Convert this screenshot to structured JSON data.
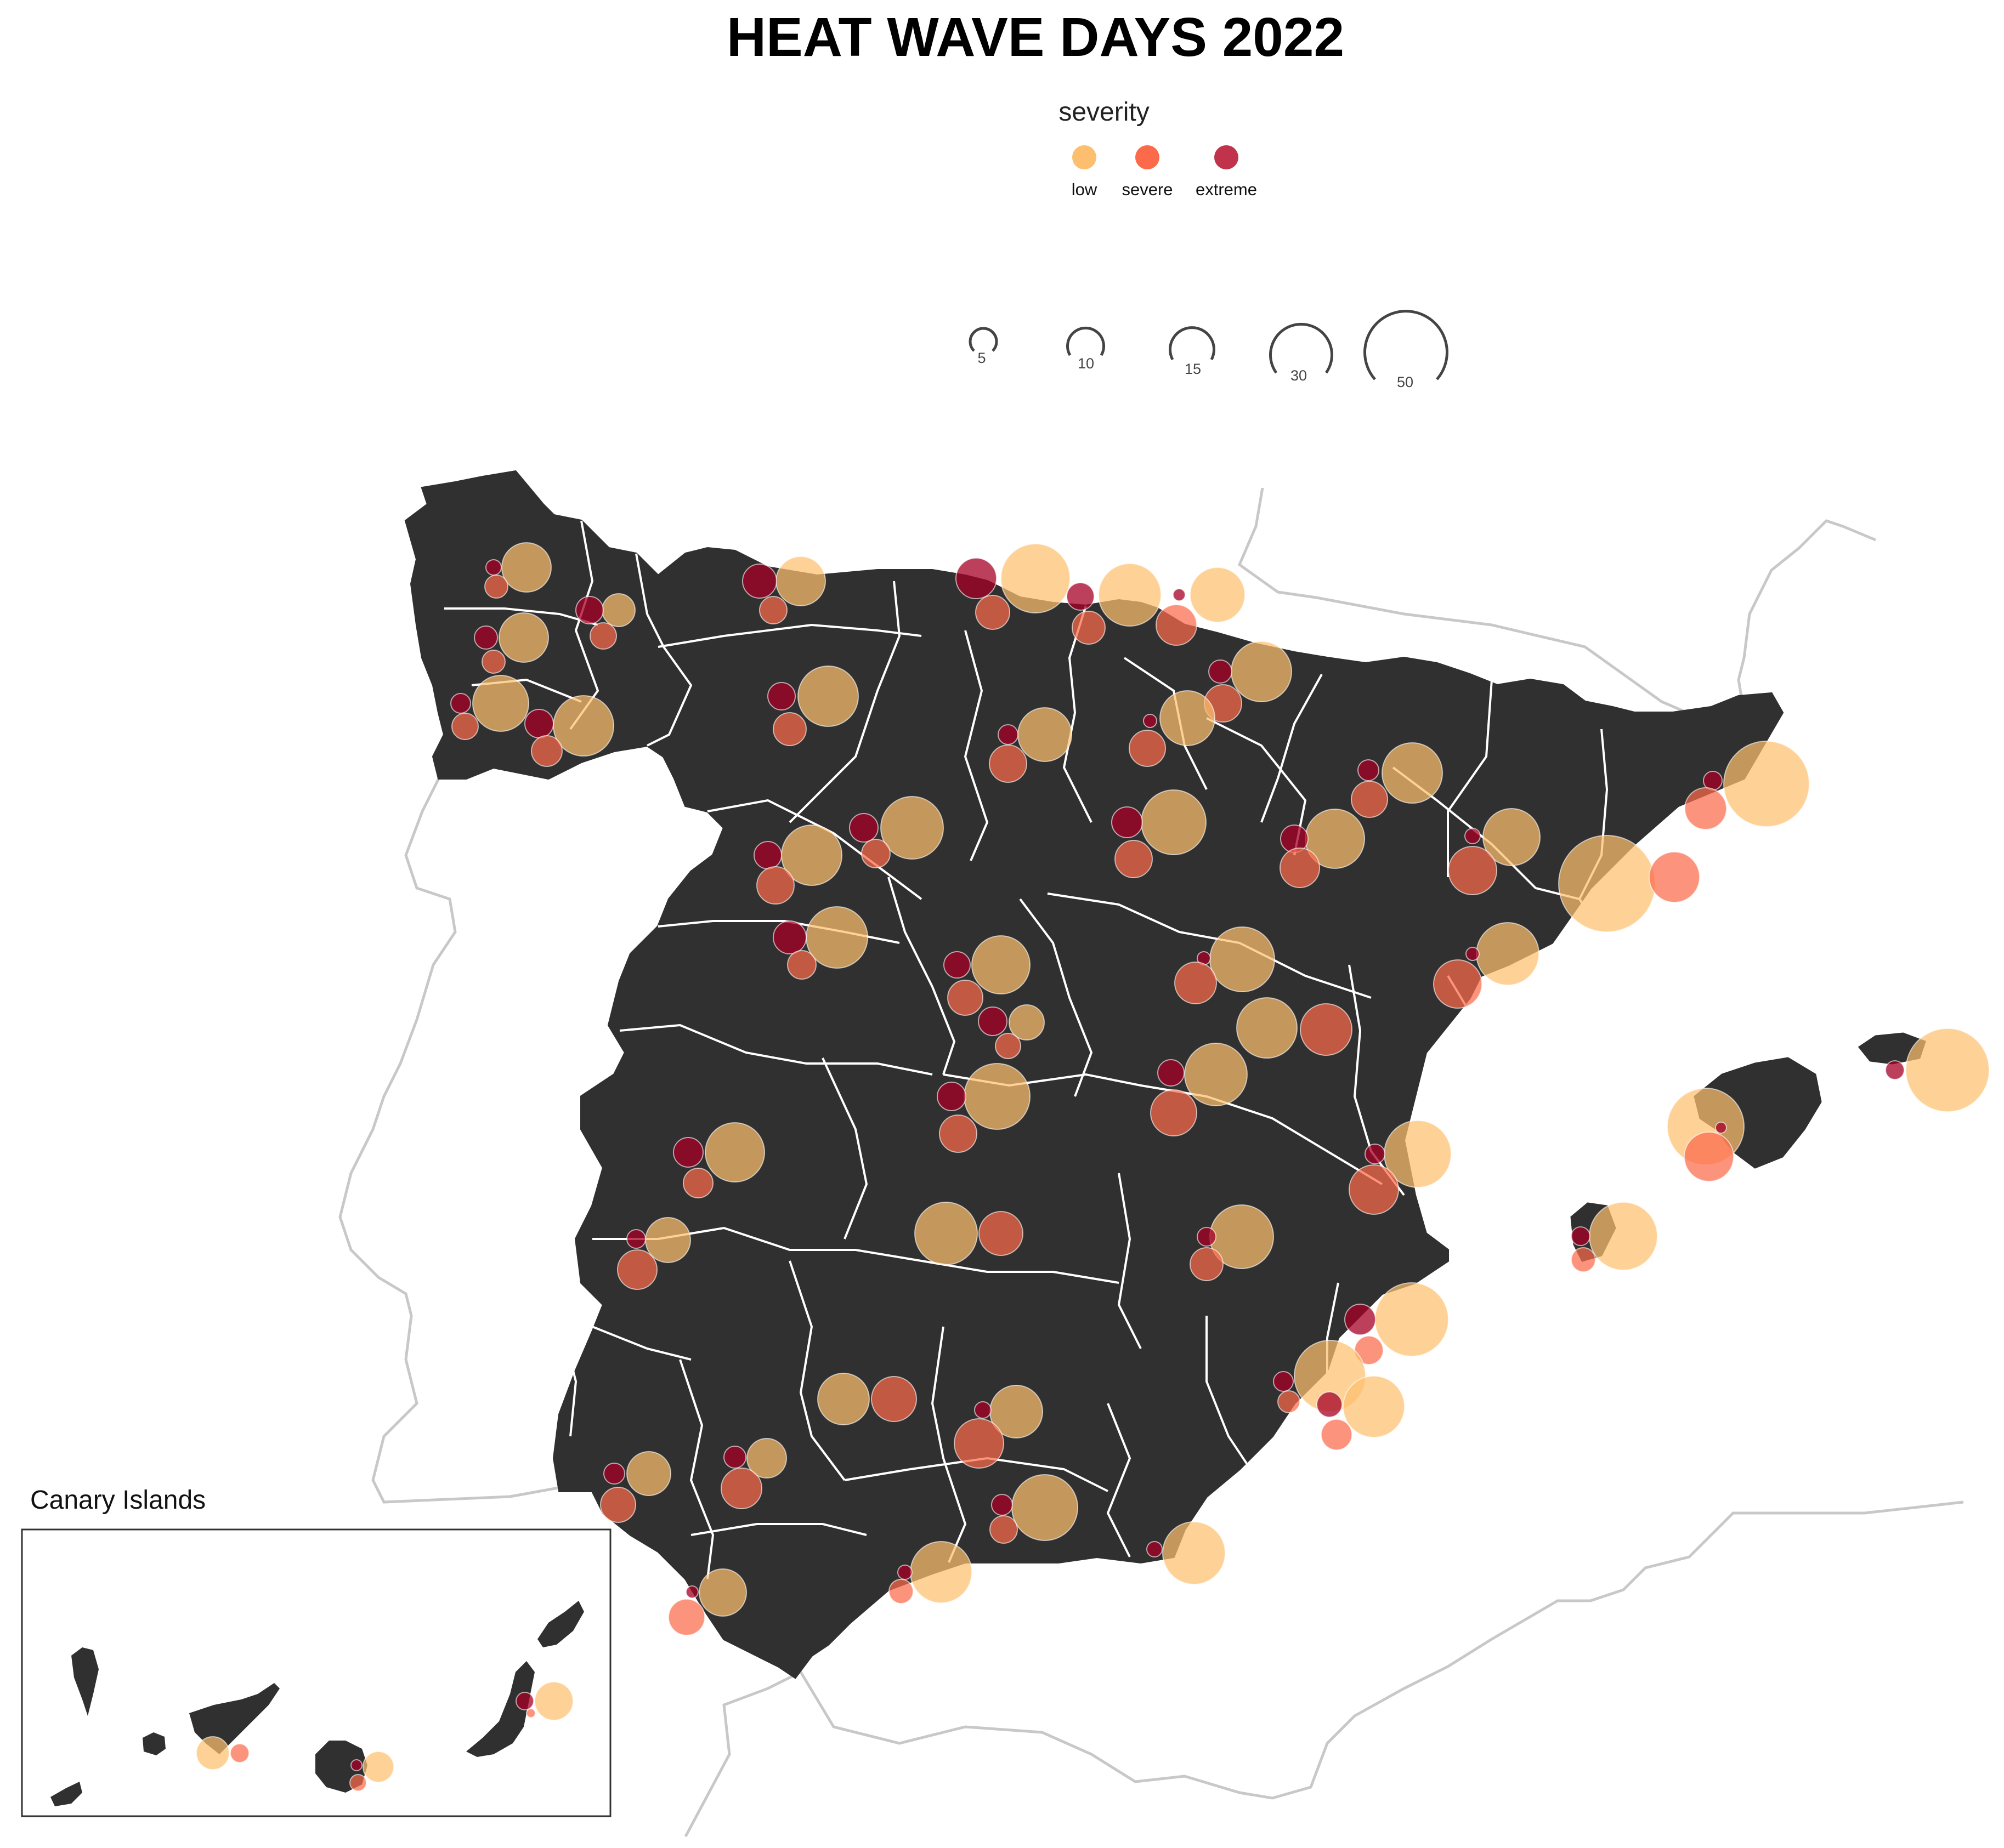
{
  "title": "HEAT WAVE DAYS 2022",
  "legend": {
    "severity_title": "severity",
    "levels": [
      {
        "label": "low",
        "color": "#fdbf6f"
      },
      {
        "label": "severe",
        "color": "#fb6a4a"
      },
      {
        "label": "extreme",
        "color": "#b2182b"
      }
    ],
    "sizes": [
      5,
      10,
      15,
      30,
      50
    ]
  },
  "inset": {
    "label": "Canary Islands"
  },
  "colors": {
    "land": "#303030",
    "borders": "#ffffff",
    "neighbours": "#c8c8c8",
    "low": "#fdbf6f",
    "severe": "#fb6a4a",
    "extreme": "#a50026"
  }
}
